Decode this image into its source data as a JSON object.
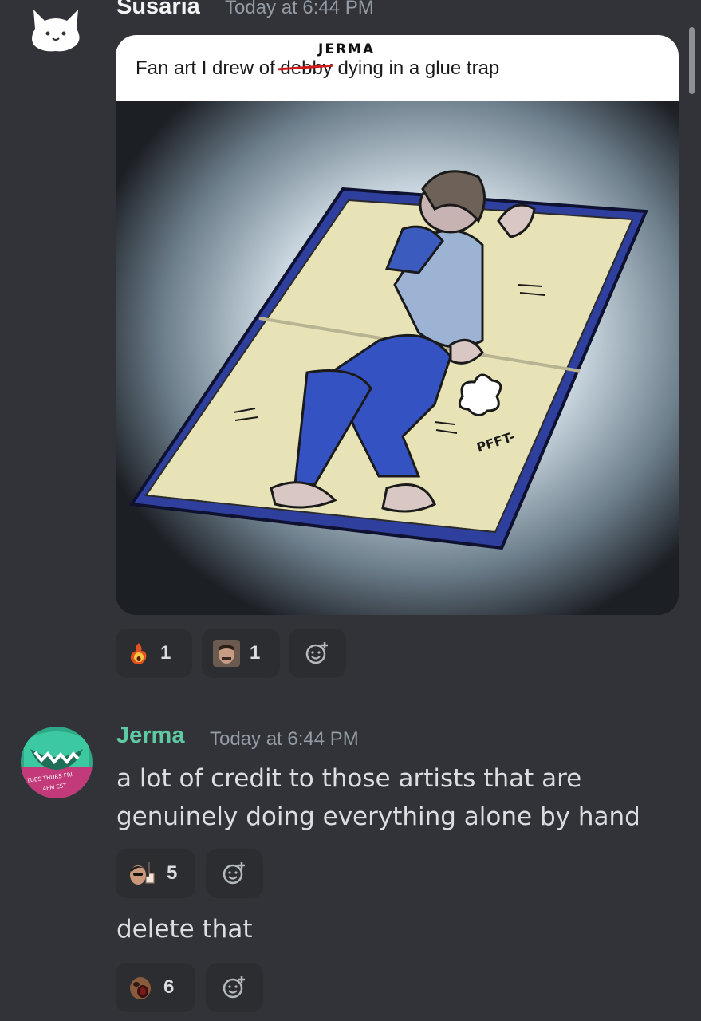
{
  "messages": [
    {
      "username": "Susaria",
      "timestamp": "Today at 6:44 PM",
      "embed": {
        "caption_before": "Fan art I drew of ",
        "caption_struck": "debby",
        "caption_after": " dying in a glue trap",
        "caption_insert": "JERMA",
        "art_sfx": "PFFT-"
      },
      "reactions": [
        {
          "emoji": "fire-face-emoji",
          "count": "1"
        },
        {
          "emoji": "jerma-face-emoji",
          "count": "1"
        }
      ]
    },
    {
      "username": "Jerma",
      "username_color": "#5fc9a4",
      "timestamp": "Today at 6:44 PM",
      "avatar_text": "TUES THURS FRI 4PM EST",
      "lines": [
        {
          "text_line1": "a lot of credit to those artists that are",
          "text_line2": "genuinely doing everything alone by hand",
          "reactions": [
            {
              "emoji": "pointing-man-emoji",
              "count": "5"
            }
          ]
        },
        {
          "text_line1": "delete that",
          "reactions": [
            {
              "emoji": "shocked-face-emoji",
              "count": "6"
            }
          ]
        }
      ]
    }
  ],
  "colors": {
    "background": "#313338",
    "reaction_bg": "#2b2d31",
    "jerma_name": "#5fc9a4"
  }
}
